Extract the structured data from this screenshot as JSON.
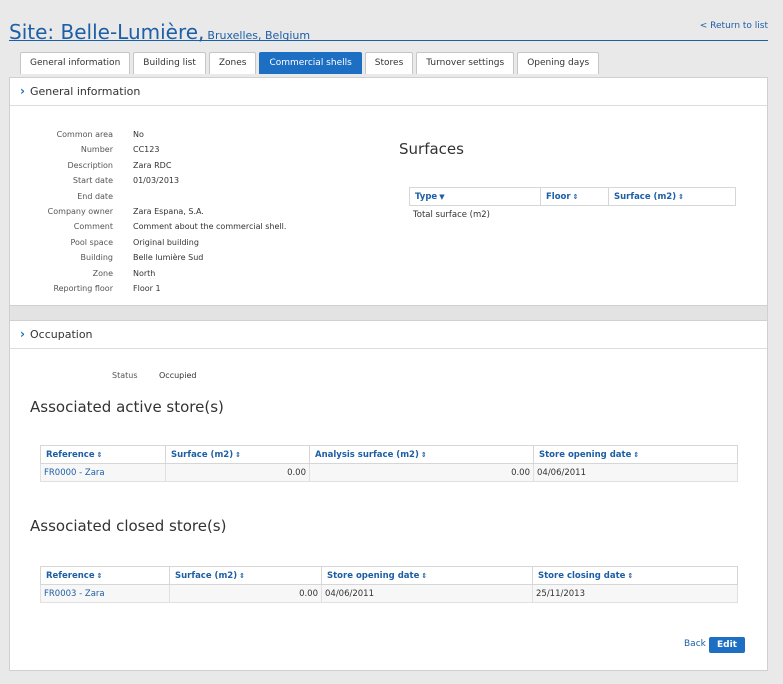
{
  "header": {
    "title": "Site: Belle-Lumière,",
    "location": "Bruxelles, Belgium",
    "return_link": "< Return to list"
  },
  "tabs": [
    {
      "label": "General information",
      "active": false
    },
    {
      "label": "Building list",
      "active": false
    },
    {
      "label": "Zones",
      "active": false
    },
    {
      "label": "Commercial shells",
      "active": true
    },
    {
      "label": "Stores",
      "active": false
    },
    {
      "label": "Turnover settings",
      "active": false
    },
    {
      "label": "Opening days",
      "active": false
    }
  ],
  "general": {
    "section_title": "General information",
    "fields": [
      {
        "label": "Common area",
        "value": "No"
      },
      {
        "label": "Number",
        "value": "CC123"
      },
      {
        "label": "Description",
        "value": "Zara RDC"
      },
      {
        "label": "Start date",
        "value": "01/03/2013"
      },
      {
        "label": "End date",
        "value": ""
      },
      {
        "label": "Company owner",
        "value": "Zara Espana, S.A."
      },
      {
        "label": "Comment",
        "value": "Comment about the commercial shell."
      },
      {
        "label": "Pool space",
        "value": "Original building"
      },
      {
        "label": "Building",
        "value": "Belle lumière Sud"
      },
      {
        "label": "Zone",
        "value": "North"
      },
      {
        "label": "Reporting floor",
        "value": "Floor 1"
      }
    ],
    "surfaces": {
      "title": "Surfaces",
      "columns": [
        "Type",
        "Floor",
        "Surface (m2)"
      ],
      "rows": [
        [
          "Total surface (m2)",
          "",
          ""
        ]
      ]
    }
  },
  "occupation": {
    "section_title": "Occupation",
    "status_label": "Status",
    "status_value": "Occupied",
    "active_title": "Associated active store(s)",
    "active_columns": [
      "Reference",
      "Surface (m2)",
      "Analysis surface (m2)",
      "Store opening date"
    ],
    "active_rows": [
      [
        "FR0000 - Zara",
        "0.00",
        "0.00",
        "04/06/2011"
      ]
    ],
    "closed_title": "Associated closed store(s)",
    "closed_columns": [
      "Reference",
      "Surface (m2)",
      "Store opening date",
      "Store closing date"
    ],
    "closed_rows": [
      [
        "FR0003 - Zara",
        "0.00",
        "04/06/2011",
        "25/11/2013"
      ]
    ]
  },
  "actions": {
    "back_label": "Back",
    "edit_label": "Edit"
  },
  "colors": {
    "accent": "#1d6fc4",
    "link": "#1d5fa6"
  }
}
